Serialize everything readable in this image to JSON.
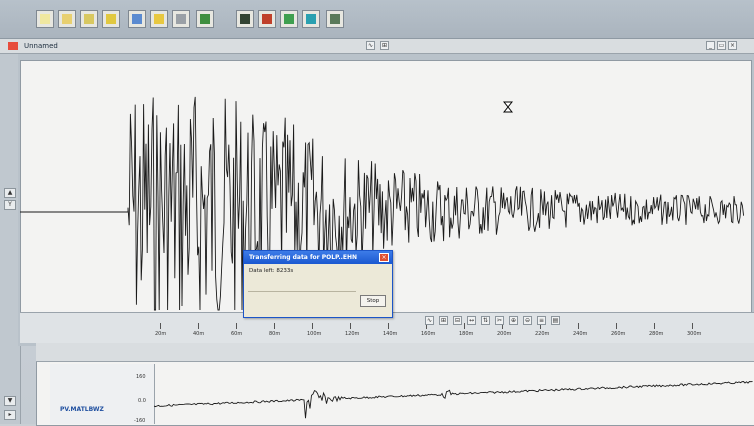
{
  "window": {
    "title": "Unnamed"
  },
  "toolbar": {
    "buttons": [
      {
        "icon": "new-file-icon",
        "color": "#f0e8a0"
      },
      {
        "icon": "open-icon",
        "color": "#e8d070"
      },
      {
        "icon": "table-icon",
        "color": "#d8c860"
      },
      {
        "icon": "grid-icon",
        "color": "#e0c840"
      },
      {
        "icon": "globe-icon",
        "color": "#5b8bd0"
      },
      {
        "icon": "folder-icon",
        "color": "#e8c840"
      },
      {
        "icon": "trash-icon",
        "color": "#9aa0a6"
      },
      {
        "icon": "filter-green-icon",
        "color": "#3f8f3f"
      },
      {
        "icon": "filter-dark-icon",
        "color": "#334433"
      },
      {
        "icon": "filter-red-icon",
        "color": "#c0402a"
      },
      {
        "icon": "filter-green2-icon",
        "color": "#3f9f4f"
      },
      {
        "icon": "filter-cyan-icon",
        "color": "#2aa0b0"
      },
      {
        "icon": "filter-gray-icon",
        "color": "#5a7a5a"
      }
    ]
  },
  "dialog": {
    "title": "Transferring data for POLP..EHN",
    "message": "Data left: 8233s",
    "stop_label": "Stop"
  },
  "scale": {
    "ticks": [
      "20m",
      "40m",
      "60m",
      "80m",
      "100m",
      "120m",
      "140m",
      "160m",
      "180m",
      "200m",
      "220m",
      "240m",
      "260m",
      "280m",
      "300m"
    ]
  },
  "lower_panel": {
    "station": "PV.MATLBWZ",
    "axis": [
      "160",
      "0.0",
      "-160"
    ]
  },
  "colors": {
    "trace": "#1a1a1a",
    "accent": "#1a58d0"
  }
}
